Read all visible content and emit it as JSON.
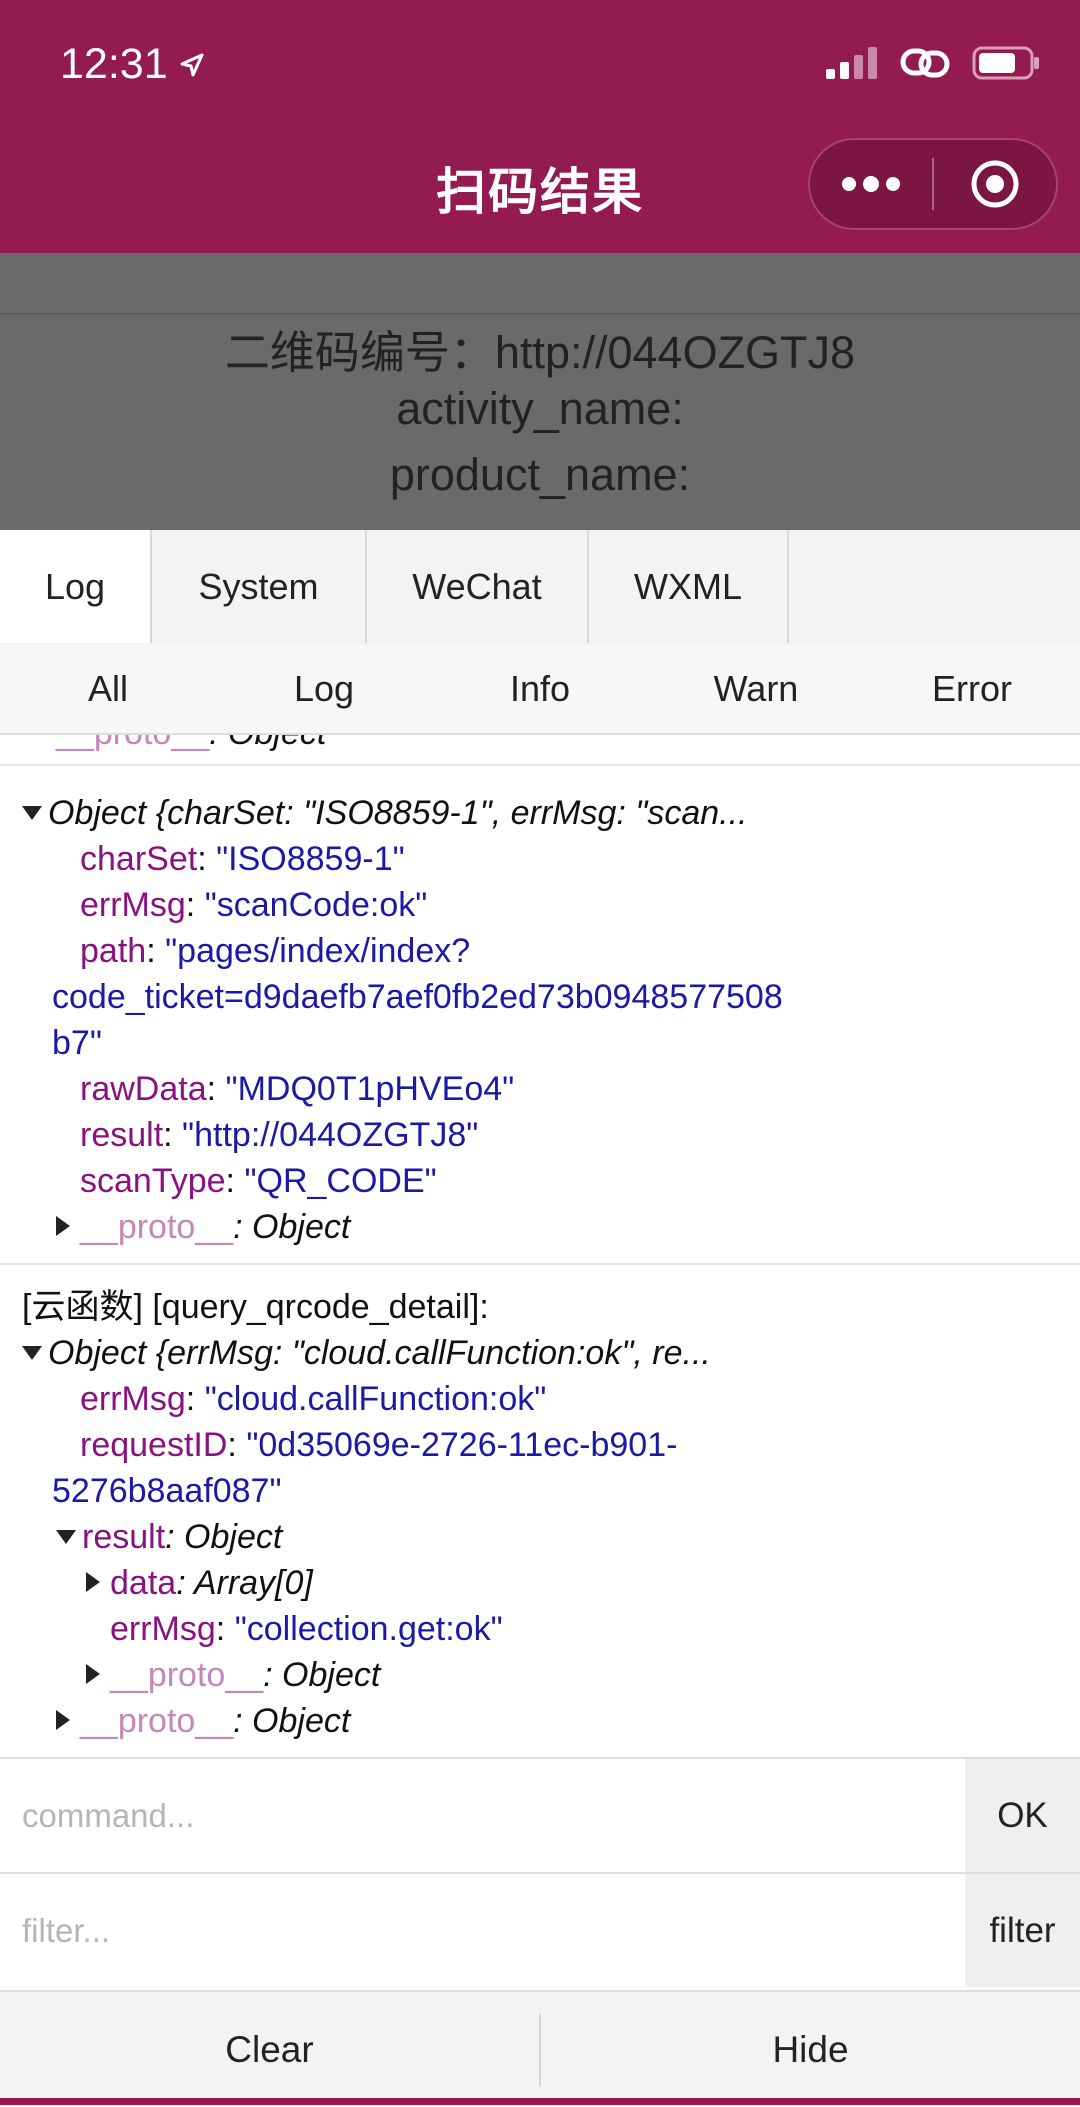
{
  "status_bar": {
    "time": "12:31"
  },
  "nav": {
    "title": "扫码结果"
  },
  "page": {
    "lines": [
      "二维码编号：http://044OZGTJ8",
      "activity_name:",
      "product_name:"
    ]
  },
  "console": {
    "top_tabs": [
      "Log",
      "System",
      "WeChat",
      "WXML"
    ],
    "filter_tabs": [
      "All",
      "Log",
      "Info",
      "Warn",
      "Error"
    ],
    "entry1": {
      "summary": "Object {charSet: \"ISO8859-1\", errMsg: \"scan...",
      "props": [
        {
          "key": "charSet",
          "value": "\"ISO8859-1\""
        },
        {
          "key": "errMsg",
          "value": "\"scanCode:ok\""
        },
        {
          "key": "path",
          "value": "\"pages/index/index?"
        },
        {
          "key": "rawData",
          "value": "\"MDQ0T1pHVEo4\""
        },
        {
          "key": "result",
          "value": "\"http://044OZGTJ8\""
        },
        {
          "key": "scanType",
          "value": "\"QR_CODE\""
        }
      ],
      "path_cont1": "code_ticket=d9daefb7aef0fb2ed73b0948577508",
      "path_cont2": "b7\"",
      "proto_key": "__proto__",
      "proto_val": ": Object"
    },
    "entry2": {
      "label": "[云函数] [query_qrcode_detail]:",
      "summary": "Object {errMsg: \"cloud.callFunction:ok\", re...",
      "errmsg_key": "errMsg",
      "errmsg_val": "\"cloud.callFunction:ok\"",
      "reqid_key": "requestID",
      "reqid_val": "\"0d35069e-2726-11ec-b901-",
      "reqid_cont": "5276b8aaf087\"",
      "result_key": "result",
      "result_val": ": Object",
      "data_key": "data",
      "data_val": ": Array[0]",
      "inner_errmsg_key": "errMsg",
      "inner_errmsg_val": "\"collection.get:ok\"",
      "proto_key": "__proto__",
      "proto_val": ": Object"
    },
    "command": {
      "placeholder": "command...",
      "button": "OK"
    },
    "filter": {
      "placeholder": "filter...",
      "button": "filter"
    },
    "actions": {
      "clear": "Clear",
      "hide": "Hide"
    }
  }
}
